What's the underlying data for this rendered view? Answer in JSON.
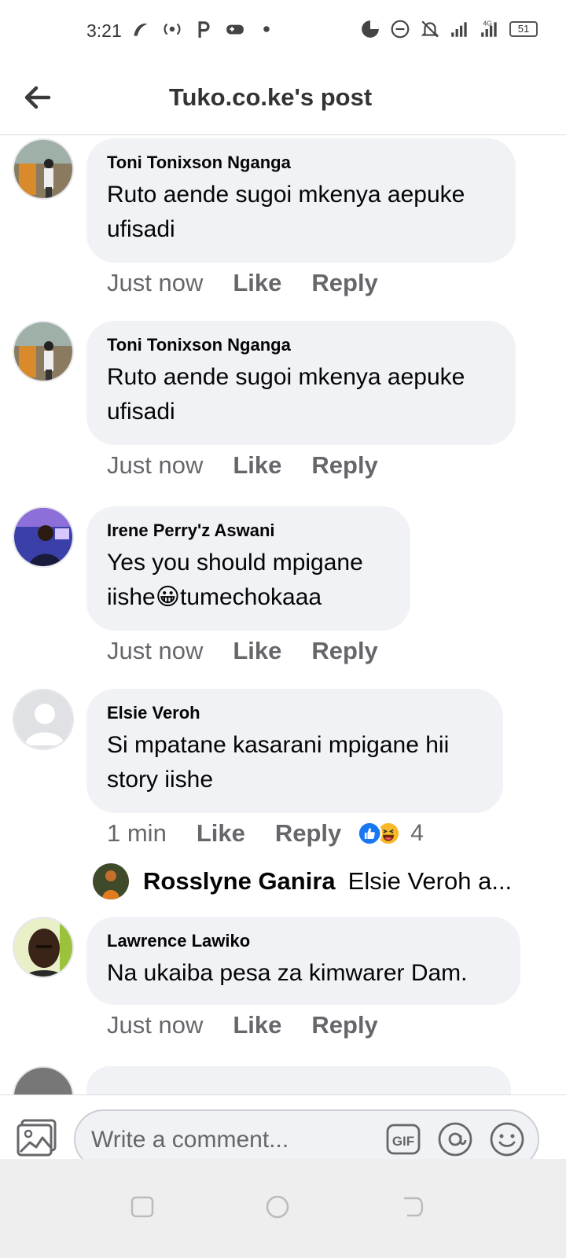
{
  "status_bar": {
    "time": "3:21",
    "network": "4G",
    "battery": "51"
  },
  "header": {
    "title": "Tuko.co.ke's post"
  },
  "comments": [
    {
      "author": "Toni Tonixson Nganga",
      "text": "Ruto aende sugoi mkenya aepuke ufisadi",
      "time": "Just now",
      "like": "Like",
      "reply": "Reply"
    },
    {
      "author": "Toni Tonixson Nganga",
      "text": "Ruto aende sugoi mkenya aepuke ufisadi",
      "time": "Just now",
      "like": "Like",
      "reply": "Reply"
    },
    {
      "author": "Irene Perry'z Aswani",
      "text_before": "Yes you should mpigane iishe",
      "emoji": "😀",
      "text_after": "tumechokaaa",
      "time": "Just now",
      "like": "Like",
      "reply": "Reply"
    },
    {
      "author": "Elsie Veroh",
      "text": "Si mpatane kasarani mpigane hii story iishe",
      "time": "1 min",
      "like": "Like",
      "reply": "Reply",
      "reaction_count": "4",
      "reply_preview": {
        "author": "Rosslyne Ganira",
        "text": "Elsie Veroh a..."
      }
    },
    {
      "author": "Lawrence Lawiko",
      "text": "Na ukaiba pesa za kimwarer Dam.",
      "time": "Just now",
      "like": "Like",
      "reply": "Reply"
    }
  ],
  "composer": {
    "placeholder": "Write a comment...",
    "gif_label": "GIF"
  },
  "colors": {
    "bubble": "#f0f2f5",
    "meta_text": "#65676b",
    "like_blue": "#1877f2",
    "haha_yellow": "#f7b928"
  }
}
